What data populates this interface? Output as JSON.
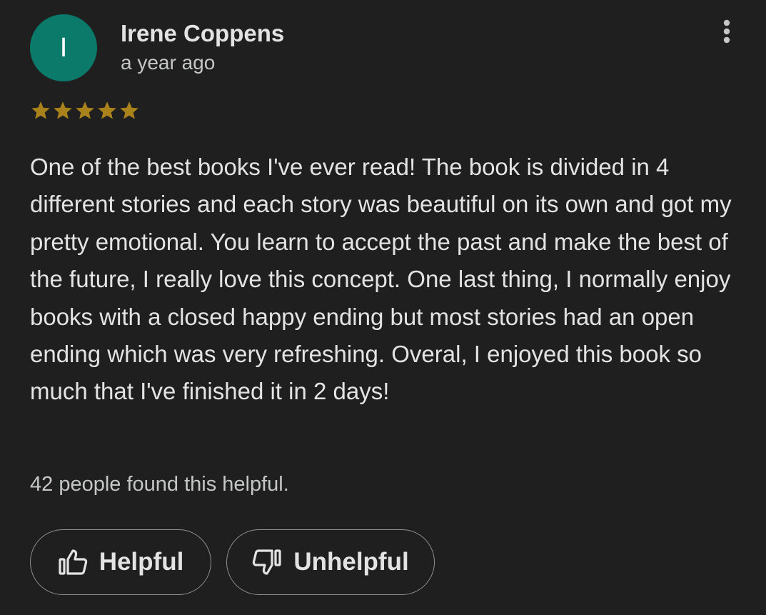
{
  "review": {
    "avatar_initial": "I",
    "avatar_color": "#0b7a6b",
    "author": "Irene Coppens",
    "date": "a year ago",
    "menu_icon": "more-vert-icon",
    "rating": 5,
    "rating_max": 5,
    "star_color": "#a9821c",
    "text": "One of the best books I've ever read! The book is divided in 4 different stories and each story was beautiful on its own and got my pretty emotional. You learn to accept the past and make the best of the future, I really love this concept. One last thing, I normally enjoy books with a closed happy ending but most stories had an open ending which was very refreshing. Overal, I enjoyed this book so much that I've finished it in 2 days!",
    "helpful_count_text": "42 people found this helpful."
  },
  "actions": {
    "helpful_label": "Helpful",
    "helpful_icon": "thumb-up-icon",
    "unhelpful_label": "Unhelpful",
    "unhelpful_icon": "thumb-down-icon"
  }
}
